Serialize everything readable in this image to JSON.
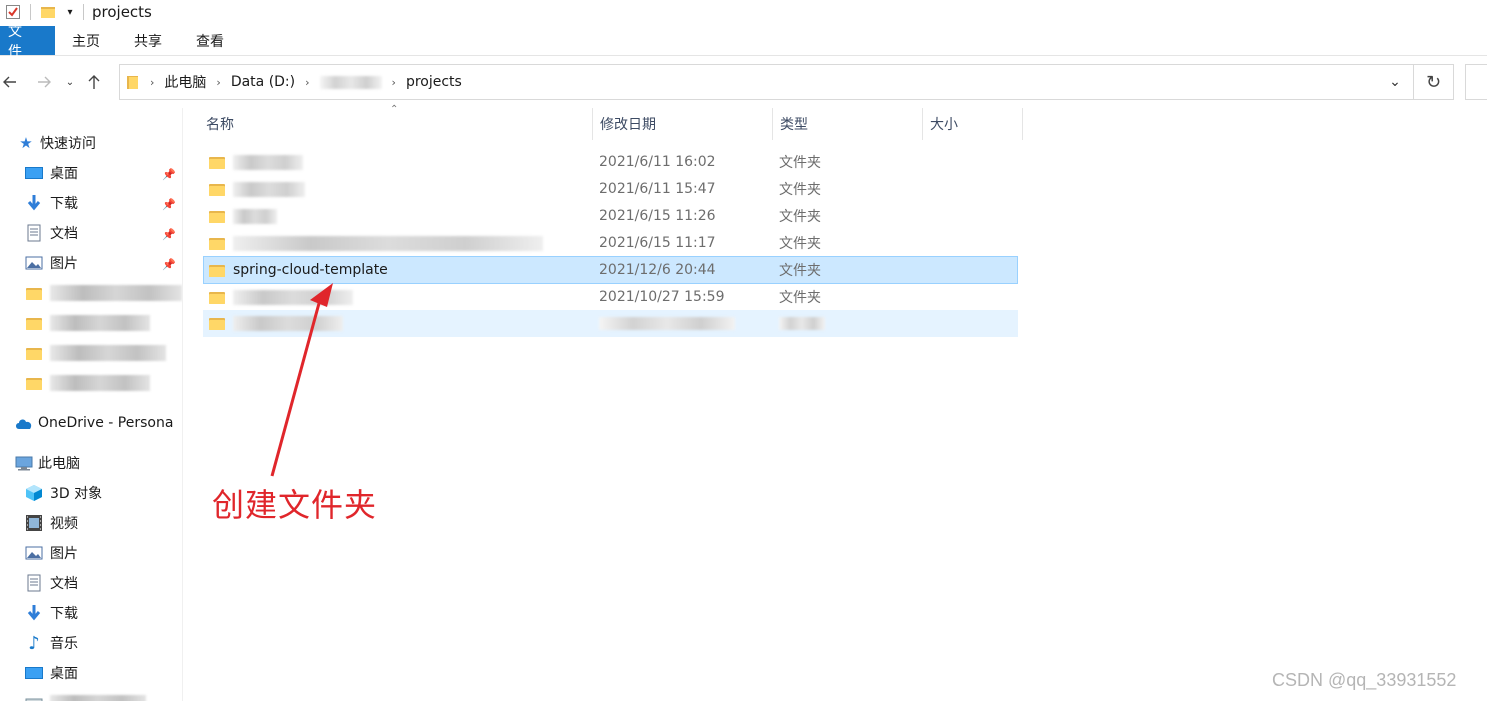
{
  "window": {
    "title": "projects"
  },
  "ribbon": {
    "tabs": [
      "文件",
      "主页",
      "共享",
      "查看"
    ]
  },
  "address": {
    "crumbs": [
      "此电脑",
      "Data (D:)",
      "",
      "projects"
    ]
  },
  "sidebar": {
    "quick_access": "快速访问",
    "pinned": [
      {
        "label": "桌面",
        "icon": "desktop-icon"
      },
      {
        "label": "下载",
        "icon": "download-icon"
      },
      {
        "label": "文档",
        "icon": "document-icon"
      },
      {
        "label": "图片",
        "icon": "picture-icon"
      }
    ],
    "onedrive": "OneDrive - Persona",
    "this_pc": "此电脑",
    "pc_items": [
      {
        "label": "3D 对象",
        "icon": "3d-objects-icon"
      },
      {
        "label": "视频",
        "icon": "video-icon"
      },
      {
        "label": "图片",
        "icon": "picture-icon"
      },
      {
        "label": "文档",
        "icon": "document-icon"
      },
      {
        "label": "下载",
        "icon": "download-icon"
      },
      {
        "label": "音乐",
        "icon": "music-icon"
      },
      {
        "label": "桌面",
        "icon": "desktop-icon"
      }
    ]
  },
  "columns": {
    "name": "名称",
    "date": "修改日期",
    "type": "类型",
    "size": "大小"
  },
  "files": [
    {
      "name": "",
      "date": "2021/6/11 16:02",
      "type": "文件夹"
    },
    {
      "name": "",
      "date": "2021/6/11 15:47",
      "type": "文件夹"
    },
    {
      "name": "",
      "date": "2021/6/15 11:26",
      "type": "文件夹"
    },
    {
      "name": "",
      "date": "2021/6/15 11:17",
      "type": "文件夹"
    },
    {
      "name": "spring-cloud-template",
      "date": "2021/12/6 20:44",
      "type": "文件夹"
    },
    {
      "name": "",
      "date": "2021/10/27 15:59",
      "type": "文件夹"
    },
    {
      "name": "",
      "date": "",
      "type": ""
    }
  ],
  "annotation": {
    "text": "创建文件夹",
    "color": "#e0262b"
  },
  "watermark": "CSDN @qq_33931552",
  "colors": {
    "ribbon_file_tab": "#1979ca",
    "selection": "#cce8ff",
    "hover": "#e5f3ff"
  }
}
